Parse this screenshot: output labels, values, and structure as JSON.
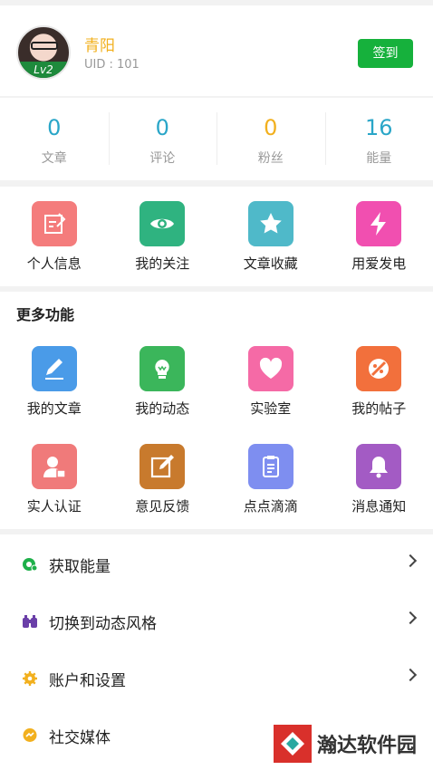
{
  "profile": {
    "name": "青阳",
    "uid": "UID : 101",
    "level": "Lv2",
    "signin_label": "签到"
  },
  "stats": [
    {
      "value": "0",
      "label": "文章",
      "color": "#2aa6c8"
    },
    {
      "value": "0",
      "label": "评论",
      "color": "#2aa6c8"
    },
    {
      "value": "0",
      "label": "粉丝",
      "color": "#f2b01e"
    },
    {
      "value": "16",
      "label": "能量",
      "color": "#2aa6c8"
    }
  ],
  "quick": [
    {
      "label": "个人信息",
      "icon": "edit-icon",
      "color": "#f47c7c"
    },
    {
      "label": "我的关注",
      "icon": "eye-icon",
      "color": "#2fb380"
    },
    {
      "label": "文章收藏",
      "icon": "star-icon",
      "color": "#4fb9c9"
    },
    {
      "label": "用爱发电",
      "icon": "lightning-icon",
      "color": "#f14fb0"
    }
  ],
  "more": {
    "title": "更多功能",
    "items": [
      {
        "label": "我的文章",
        "icon": "pencil-icon",
        "color": "#4a9be8"
      },
      {
        "label": "我的动态",
        "icon": "bulb-icon",
        "color": "#3bb65b"
      },
      {
        "label": "实验室",
        "icon": "heart-icon",
        "color": "#f56aa6"
      },
      {
        "label": "我的帖子",
        "icon": "no-icon",
        "color": "#f2703c"
      },
      {
        "label": "实人认证",
        "icon": "user-lock-icon",
        "color": "#f07a7a"
      },
      {
        "label": "意见反馈",
        "icon": "feedback-icon",
        "color": "#c87a2d"
      },
      {
        "label": "点点滴滴",
        "icon": "clipboard-icon",
        "color": "#7e8ef0"
      },
      {
        "label": "消息通知",
        "icon": "bell-icon",
        "color": "#a35bc4"
      }
    ]
  },
  "menu": [
    {
      "label": "获取能量",
      "icon": "energy-icon",
      "color": "#1eb04a"
    },
    {
      "label": "切换到动态风格",
      "icon": "binoculars-icon",
      "color": "#6a3fa8"
    },
    {
      "label": "账户和设置",
      "icon": "gear-icon",
      "color": "#f2b01e"
    },
    {
      "label": "社交媒体",
      "icon": "chat-icon",
      "color": "#f2b01e"
    }
  ],
  "watermark": "瀚达软件园"
}
